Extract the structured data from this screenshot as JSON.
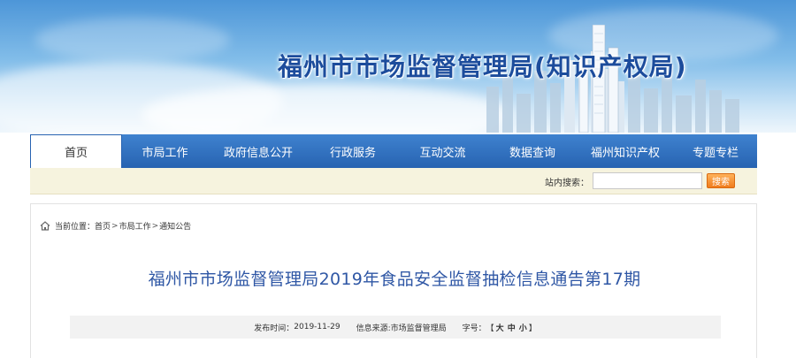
{
  "header": {
    "site_title": "福州市市场监督管理局(知识产权局)"
  },
  "nav": {
    "items": [
      {
        "label": "首页",
        "active": true
      },
      {
        "label": "市局工作"
      },
      {
        "label": "政府信息公开"
      },
      {
        "label": "行政服务"
      },
      {
        "label": "互动交流"
      },
      {
        "label": "数据查询"
      },
      {
        "label": "福州知识产权"
      },
      {
        "label": "专题专栏"
      }
    ]
  },
  "search": {
    "label": "站内搜索：",
    "value": "",
    "button_label": "搜索"
  },
  "breadcrumb": {
    "prefix": "当前位置：",
    "items": [
      "首页",
      "市局工作",
      "通知公告"
    ],
    "separator": ">"
  },
  "article": {
    "title": "福州市市场监督管理局2019年食品安全监督抽检信息通告第17期",
    "publish_label": "发布时间：",
    "publish_date": "2019-11-29",
    "source_label": "信息来源:",
    "source_value": "市场监督管理局",
    "font_label": "字号：",
    "font_open": "【",
    "font_large": "大",
    "font_medium": "中",
    "font_small": "小",
    "font_close": "】"
  },
  "colors": {
    "nav_bg": "#2763b1",
    "title_blue": "#2f57a5",
    "site_title_blue": "#1c4c9c",
    "search_button": "#f07c1c",
    "search_bar_bg": "#f6f3de"
  },
  "icons": {
    "breadcrumb": "home-icon"
  }
}
